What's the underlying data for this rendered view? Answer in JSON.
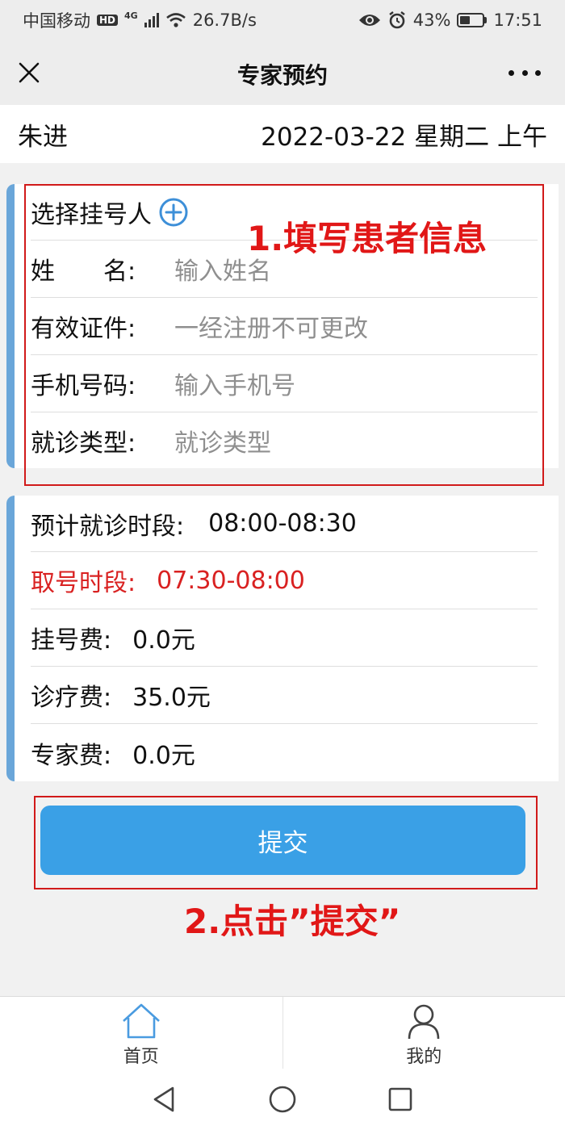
{
  "status_bar": {
    "carrier": "中国移动",
    "hd_badge": "HD",
    "network_type": "4G",
    "speed": "26.7B/s",
    "battery_percent": "43%",
    "battery_level": 0.43,
    "time": "17:51",
    "icons": [
      "signal-icon",
      "wifi-icon",
      "eye-icon",
      "alarm-icon",
      "battery-icon"
    ]
  },
  "nav": {
    "title": "专家预约",
    "close_icon": "close-icon",
    "more_icon": "more-icon"
  },
  "doctor_info": {
    "name": "朱进",
    "date": "2022-03-22 星期二 上午"
  },
  "patient_form": {
    "select_label": "选择挂号人",
    "add_icon": "plus-circle-icon",
    "fields": [
      {
        "label": "姓　　名:",
        "placeholder": "输入姓名"
      },
      {
        "label": "有效证件:",
        "placeholder": "一经注册不可更改"
      },
      {
        "label": "手机号码:",
        "placeholder": "输入手机号"
      },
      {
        "label": "就诊类型:",
        "placeholder": "就诊类型"
      }
    ]
  },
  "appointment": {
    "visit_time_label": "预计就诊时段:",
    "visit_time_value": "08:00-08:30",
    "pickup_label": "取号时段:",
    "pickup_value": "07:30-08:00",
    "reg_fee_label": "挂号费:",
    "reg_fee_value": "0.0元",
    "treat_fee_label": "诊疗费:",
    "treat_fee_value": "35.0元",
    "expert_fee_label": "专家费:",
    "expert_fee_value": "0.0元"
  },
  "submit_label": "提交",
  "annotations": {
    "step1": "1.填写患者信息",
    "step2": "2.点击”提交”",
    "color": "#e11717"
  },
  "tabbar": {
    "home": "首页",
    "mine": "我的"
  },
  "colors": {
    "accent": "#3aa0e6",
    "card_border": "#6aa6d9",
    "warning": "#d92121"
  }
}
